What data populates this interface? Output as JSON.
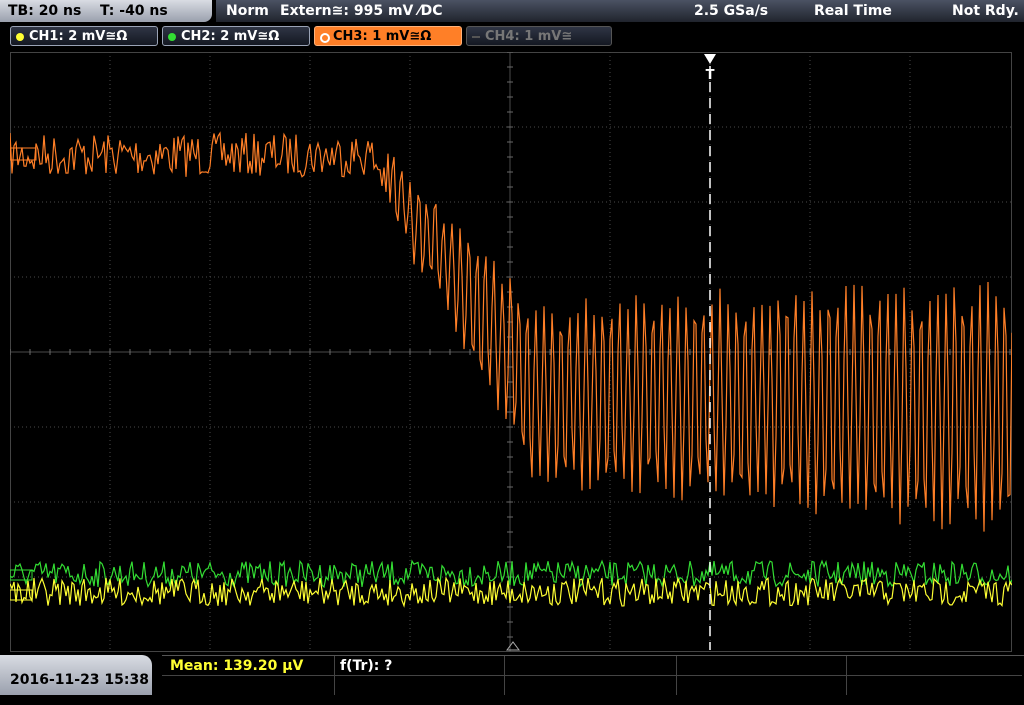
{
  "header": {
    "timebase": "TB: 20 ns",
    "trigger_time": "T: -40 ns",
    "mode": "Norm",
    "trigger_source": "Extern≅: 995 mV ⁄DC",
    "sample_rate": "2.5 GSa/s",
    "acq_mode": "Real Time",
    "status": "Not Rdy."
  },
  "channels": [
    {
      "label": "CH1: 2 mV≅Ω",
      "color": "#ffff33",
      "active": true
    },
    {
      "label": "CH2: 2 mV≅Ω",
      "color": "#33cc33",
      "active": true
    },
    {
      "label": "CH3: 1 mV≅Ω",
      "color": "#ff7f27",
      "active": true,
      "selected": true
    },
    {
      "label": "CH4: 1 mV≅",
      "color": "#888888",
      "active": false
    }
  ],
  "trigger_marker": "T",
  "footer": {
    "datetime": "2016-11-23 15:38",
    "mean_label": "Mean: 139.20 µV",
    "ftr_label": "f(Tr): ?"
  },
  "colors": {
    "ch1": "#ffff33",
    "ch2": "#33dd33",
    "ch3": "#ff7f27",
    "grid": "#555555"
  }
}
